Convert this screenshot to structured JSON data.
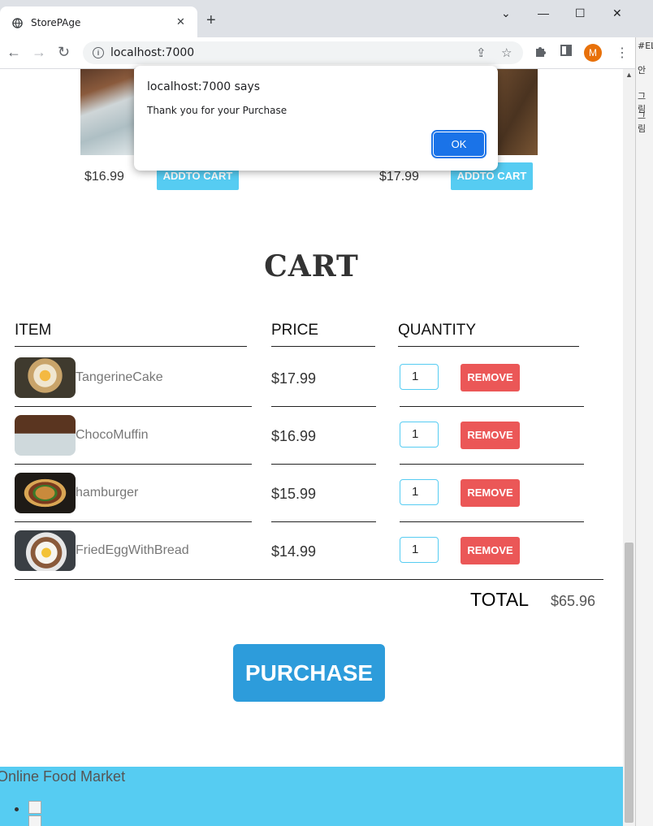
{
  "browser": {
    "tab_title": "StorePAge",
    "tab_close": "✕",
    "new_tab": "+",
    "url": "localhost:7000",
    "profile_initial": "M",
    "window_controls": [
      "⌄",
      "—",
      "☐",
      "✕"
    ],
    "side_text": [
      "#EL",
      "안",
      "그림",
      "그림"
    ]
  },
  "shop": {
    "items": [
      {
        "price": "$16.99",
        "button": "ADDTO CART"
      },
      {
        "price": "$17.99",
        "button": "ADDTO CART"
      }
    ]
  },
  "cart": {
    "title": "CART",
    "headers": {
      "item": "ITEM",
      "price": "PRICE",
      "quantity": "QUANTITY"
    },
    "rows": [
      {
        "name": "TangerineCake",
        "price": "$17.99",
        "quantity": "1",
        "remove": "REMOVE"
      },
      {
        "name": "ChocoMuffin",
        "price": "$16.99",
        "quantity": "1",
        "remove": "REMOVE"
      },
      {
        "name": "hamburger",
        "price": "$15.99",
        "quantity": "1",
        "remove": "REMOVE"
      },
      {
        "name": "FriedEggWithBread",
        "price": "$14.99",
        "quantity": "1",
        "remove": "REMOVE"
      }
    ],
    "total_label": "TOTAL",
    "total_value": "$65.96",
    "purchase": "PURCHASE"
  },
  "footer": {
    "title": "Online Food Market"
  },
  "dialog": {
    "title": "localhost:7000 says",
    "message": "Thank you for your Purchase",
    "ok": "OK"
  }
}
